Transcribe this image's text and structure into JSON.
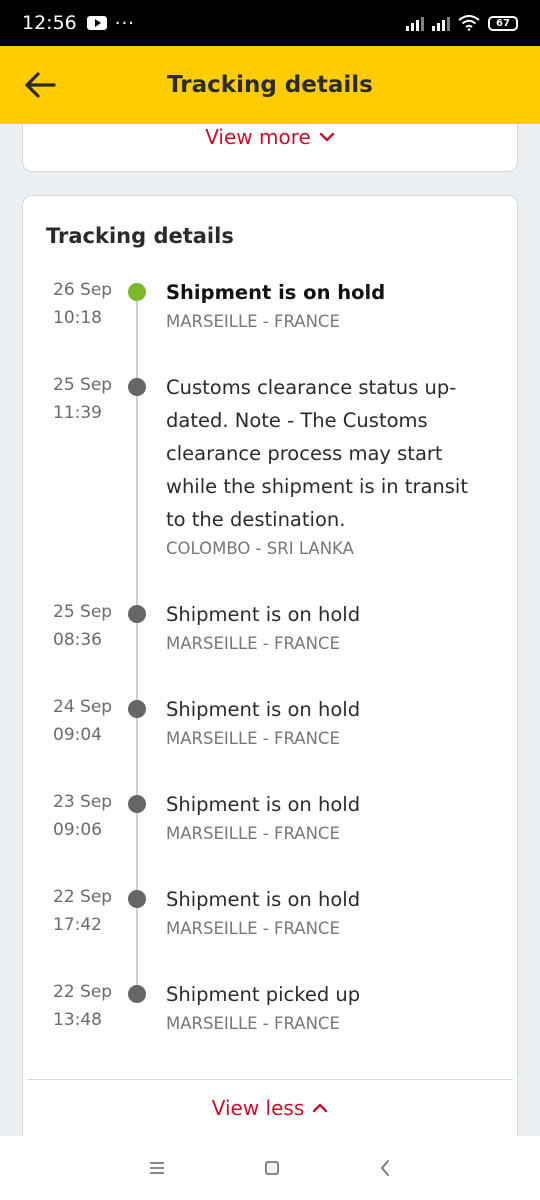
{
  "status_bar": {
    "time": "12:56",
    "more": "···",
    "battery": "67"
  },
  "app_bar": {
    "title": "Tracking details"
  },
  "top_card": {
    "view_more": "View more"
  },
  "tracking": {
    "title": "Tracking details",
    "events": [
      {
        "date": "26 Sep",
        "time": "10:18",
        "description": "Shipment is on hold",
        "location": "MARSEILLE - FRANCE"
      },
      {
        "date": "25 Sep",
        "time": "11:39",
        "description": "Customs clearance status up-dated. Note - The Customs clearance process may start while the shipment is in transit to the destination.",
        "location": "COLOMBO - SRI LANKA"
      },
      {
        "date": "25 Sep",
        "time": "08:36",
        "description": "Shipment is on hold",
        "location": "MARSEILLE - FRANCE"
      },
      {
        "date": "24 Sep",
        "time": "09:04",
        "description": "Shipment is on hold",
        "location": "MARSEILLE - FRANCE"
      },
      {
        "date": "23 Sep",
        "time": "09:06",
        "description": "Shipment is on hold",
        "location": "MARSEILLE - FRANCE"
      },
      {
        "date": "22 Sep",
        "time": "17:42",
        "description": "Shipment is on hold",
        "location": "MARSEILLE - FRANCE"
      },
      {
        "date": "22 Sep",
        "time": "13:48",
        "description": "Shipment picked up",
        "location": "MARSEILLE - FRANCE"
      }
    ],
    "view_less": "View less"
  },
  "colors": {
    "accent_yellow": "#ffcc00",
    "link_red": "#c8102e",
    "active_dot": "#7ab929"
  },
  "icons": {
    "back": "arrow-left-icon",
    "chevron_down": "chevron-down-icon",
    "chevron_up": "chevron-up-icon"
  }
}
